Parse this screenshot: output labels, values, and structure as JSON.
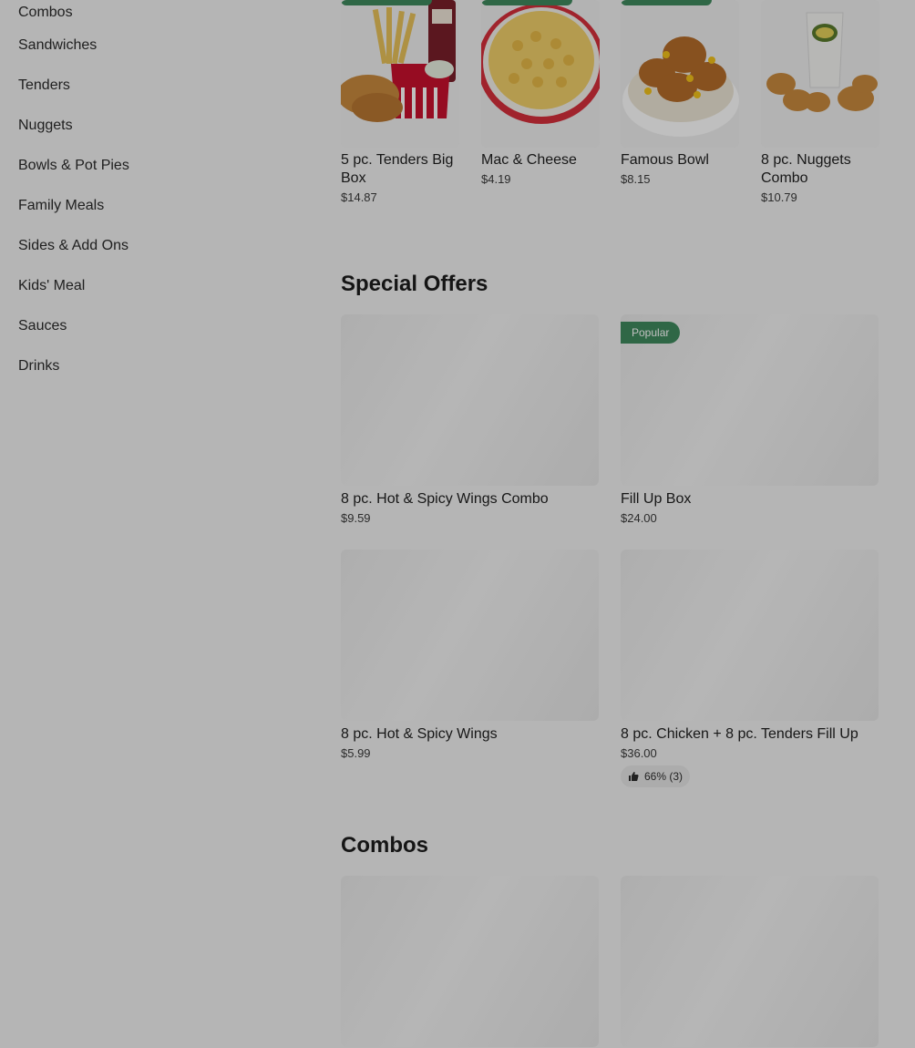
{
  "sidebar": {
    "items": [
      "Combos",
      "Sandwiches",
      "Tenders",
      "Nuggets",
      "Bowls & Pot Pies",
      "Family Meals",
      "Sides & Add Ons",
      "Kids' Meal",
      "Sauces",
      "Drinks"
    ]
  },
  "top_items": [
    {
      "name": "5 pc. Tenders Big Box",
      "price": "$14.87"
    },
    {
      "name": "Mac & Cheese",
      "price": "$4.19"
    },
    {
      "name": "Famous Bowl",
      "price": "$8.15"
    },
    {
      "name": "8 pc. Nuggets Combo",
      "price": "$10.79"
    }
  ],
  "special_offers": {
    "title": "Special Offers",
    "items": [
      {
        "name": "8 pc. Hot & Spicy Wings Combo",
        "price": "$9.59"
      },
      {
        "name": "Fill Up Box",
        "price": "$24.00",
        "badge": "Popular"
      },
      {
        "name": "8 pc. Hot & Spicy Wings",
        "price": "$5.99"
      },
      {
        "name": "8 pc. Chicken + 8 pc. Tenders Fill Up",
        "price": "$36.00",
        "rating": "66% (3)"
      }
    ]
  },
  "combos": {
    "title": "Combos"
  },
  "colors": {
    "accent": "#3f8a5e",
    "background": "#f2f2f2"
  }
}
